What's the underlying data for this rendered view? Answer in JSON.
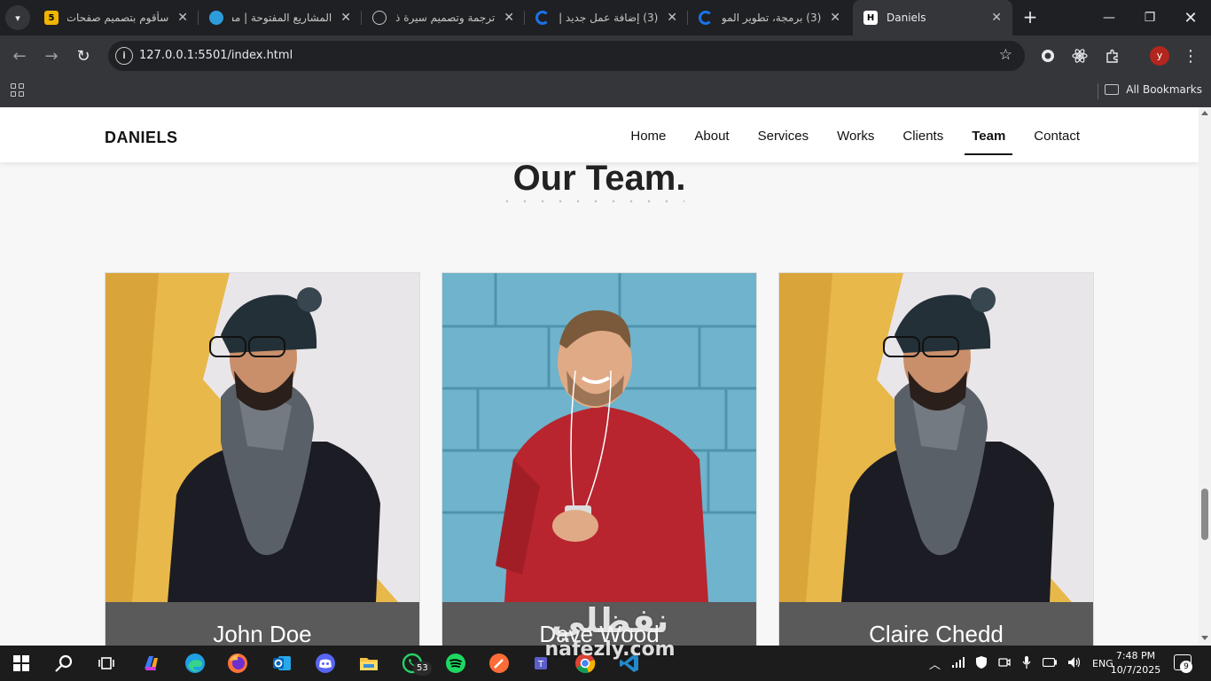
{
  "browser": {
    "tabs": [
      {
        "title": "سأقوم بتصميم صفحات",
        "favicon_color": "#f0b400",
        "favicon_text": "5",
        "active": false
      },
      {
        "title": "المشاريع المفتوحة | مس",
        "favicon_color": "#2d9cdb",
        "favicon_text": "",
        "active": false
      },
      {
        "title": "ترجمة وتصميم سيرة ذا",
        "favicon_color": "#c4c7c5",
        "favicon_text": "",
        "active": false
      },
      {
        "title": "(3) إضافة عمل جديد | ",
        "favicon_color": "#1a73e8",
        "favicon_text": "",
        "active": false
      },
      {
        "title": "(3) برمجة، تطوير الموا",
        "favicon_color": "#1a73e8",
        "favicon_text": "",
        "active": false
      },
      {
        "title": "Daniels",
        "favicon_color": "#000000",
        "favicon_text": "H",
        "active": true
      }
    ],
    "address_url": "127.0.0.1:5501/index.html",
    "all_bookmarks_label": "All Bookmarks",
    "profile_initial": "y"
  },
  "site": {
    "brand": "DANIELS",
    "nav": [
      "Home",
      "About",
      "Services",
      "Works",
      "Clients",
      "Team",
      "Contact"
    ],
    "active_nav": "Team",
    "section_title": "Our Team.",
    "members": [
      {
        "name": "John Doe",
        "photo": "man-beanie-scarf-glasses"
      },
      {
        "name": "Dave Wood",
        "photo": "man-red-sweater-headphones"
      },
      {
        "name": "Claire Chedd",
        "photo": "man-beanie-scarf-glasses"
      }
    ]
  },
  "watermark": {
    "arabic": "نفظلي",
    "latin": "nafezly.com"
  },
  "taskbar": {
    "whatsapp_badge": "53",
    "language": "ENG",
    "time": "7:48 PM",
    "date": "10/7/2025",
    "notifications": "9"
  },
  "colors": {
    "accent": "#111111",
    "page_bg": "#f7f7f7",
    "card_caption": "#5a5a5a"
  }
}
